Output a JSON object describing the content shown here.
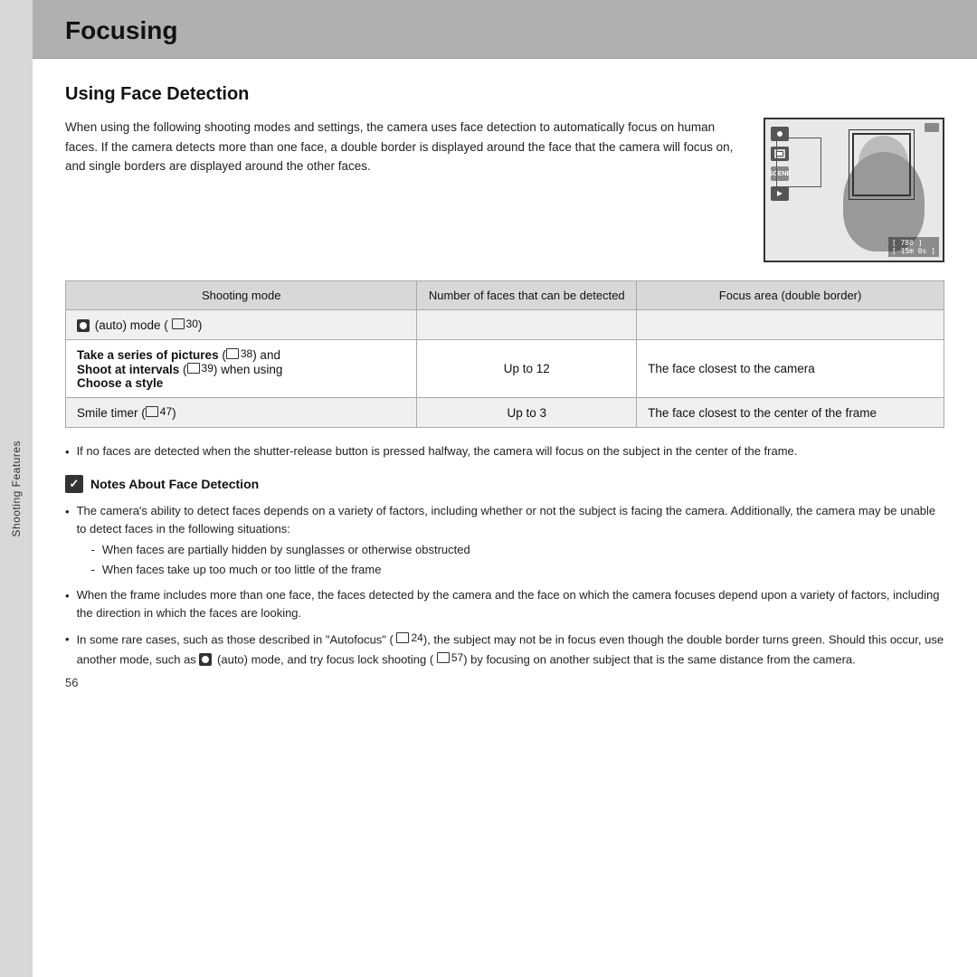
{
  "header": {
    "title": "Focusing",
    "background_color": "#b0b0b0"
  },
  "sidebar": {
    "label": "Shooting Features"
  },
  "section": {
    "title": "Using Face Detection",
    "intro": "When using the following shooting modes and settings, the camera uses face detection to automatically focus on human faces. If the camera detects more than one face, a double border is displayed around the face that the camera will focus on, and single borders are displayed around the other faces."
  },
  "table": {
    "col1_header": "Shooting mode",
    "col2_header": "Number of faces that can be detected",
    "col3_header": "Focus area (double border)",
    "rows": [
      {
        "mode": "(auto) mode (  30)",
        "mode_icon": true,
        "number": "",
        "focus": "",
        "gray": true
      },
      {
        "mode": "Take a series of pictures (  38) and Shoot at intervals (  39) when using Choose a style",
        "mode_bold_parts": [
          "Take a series of pictures",
          "Shoot at intervals",
          "Choose a style"
        ],
        "number": "Up to 12",
        "focus": "The face closest to the camera",
        "gray": false
      },
      {
        "mode": "Smile timer (  47)",
        "number": "Up to 3",
        "focus": "The face closest to the center of the frame",
        "gray": true
      }
    ]
  },
  "bullet_note": "If no faces are detected when the shutter-release button is pressed halfway, the camera will focus on the subject in the center of the frame.",
  "notes_title": "Notes About Face Detection",
  "notes": [
    {
      "text": "The camera's ability to detect faces depends on a variety of factors, including whether or not the subject is facing the camera. Additionally, the camera may be unable to detect faces in the following situations:",
      "sub_items": [
        "When faces are partially hidden by sunglasses or otherwise obstructed",
        "When faces take up too much or too little of the frame"
      ]
    },
    {
      "text": "When the frame includes more than one face, the faces detected by the camera and the face on which the camera focuses depend upon a variety of factors, including the direction in which the faces are looking.",
      "sub_items": []
    },
    {
      "text": "In some rare cases, such as those described in \"Autofocus\" (  24), the subject may not be in focus even though the double border turns green. Should this occur, use another mode, such as   (auto) mode, and try focus lock shooting (  57) by focusing on another subject that is the same distance from the camera.",
      "sub_items": []
    }
  ],
  "page_number": "56"
}
